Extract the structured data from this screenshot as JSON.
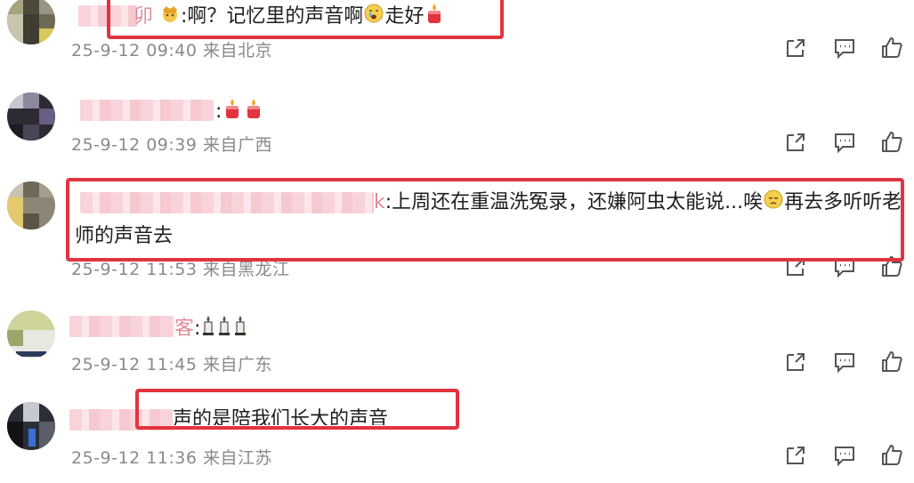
{
  "comments": [
    {
      "name_tail": "卯",
      "text": ":啊？记忆里的声音啊",
      "text_after": "走好",
      "meta": "25-9-12 09:40 来自北京"
    },
    {
      "text": ":",
      "meta": "25-9-12 09:39 来自广西"
    },
    {
      "name_tail": "k",
      "text": ":上周还在重温洗冤录，还嫌阿虫太能说...唉",
      "text_after": "再去多听听老",
      "text_line2": "师的声音去",
      "meta": "25-9-12 11:53 来自黑龙江"
    },
    {
      "name_tail": "客",
      "text": ":",
      "meta": "25-9-12 11:45 来自广东"
    },
    {
      "text": "声的是陪我们长大的声音",
      "meta": "25-9-12 11:36 来自江苏"
    }
  ],
  "icons": {
    "share": "share-icon",
    "comment": "comment-icon",
    "like": "like-icon"
  },
  "colors": {
    "highlight": "#e2333f",
    "meta_text": "#8a8a8a",
    "icon": "#555555"
  }
}
